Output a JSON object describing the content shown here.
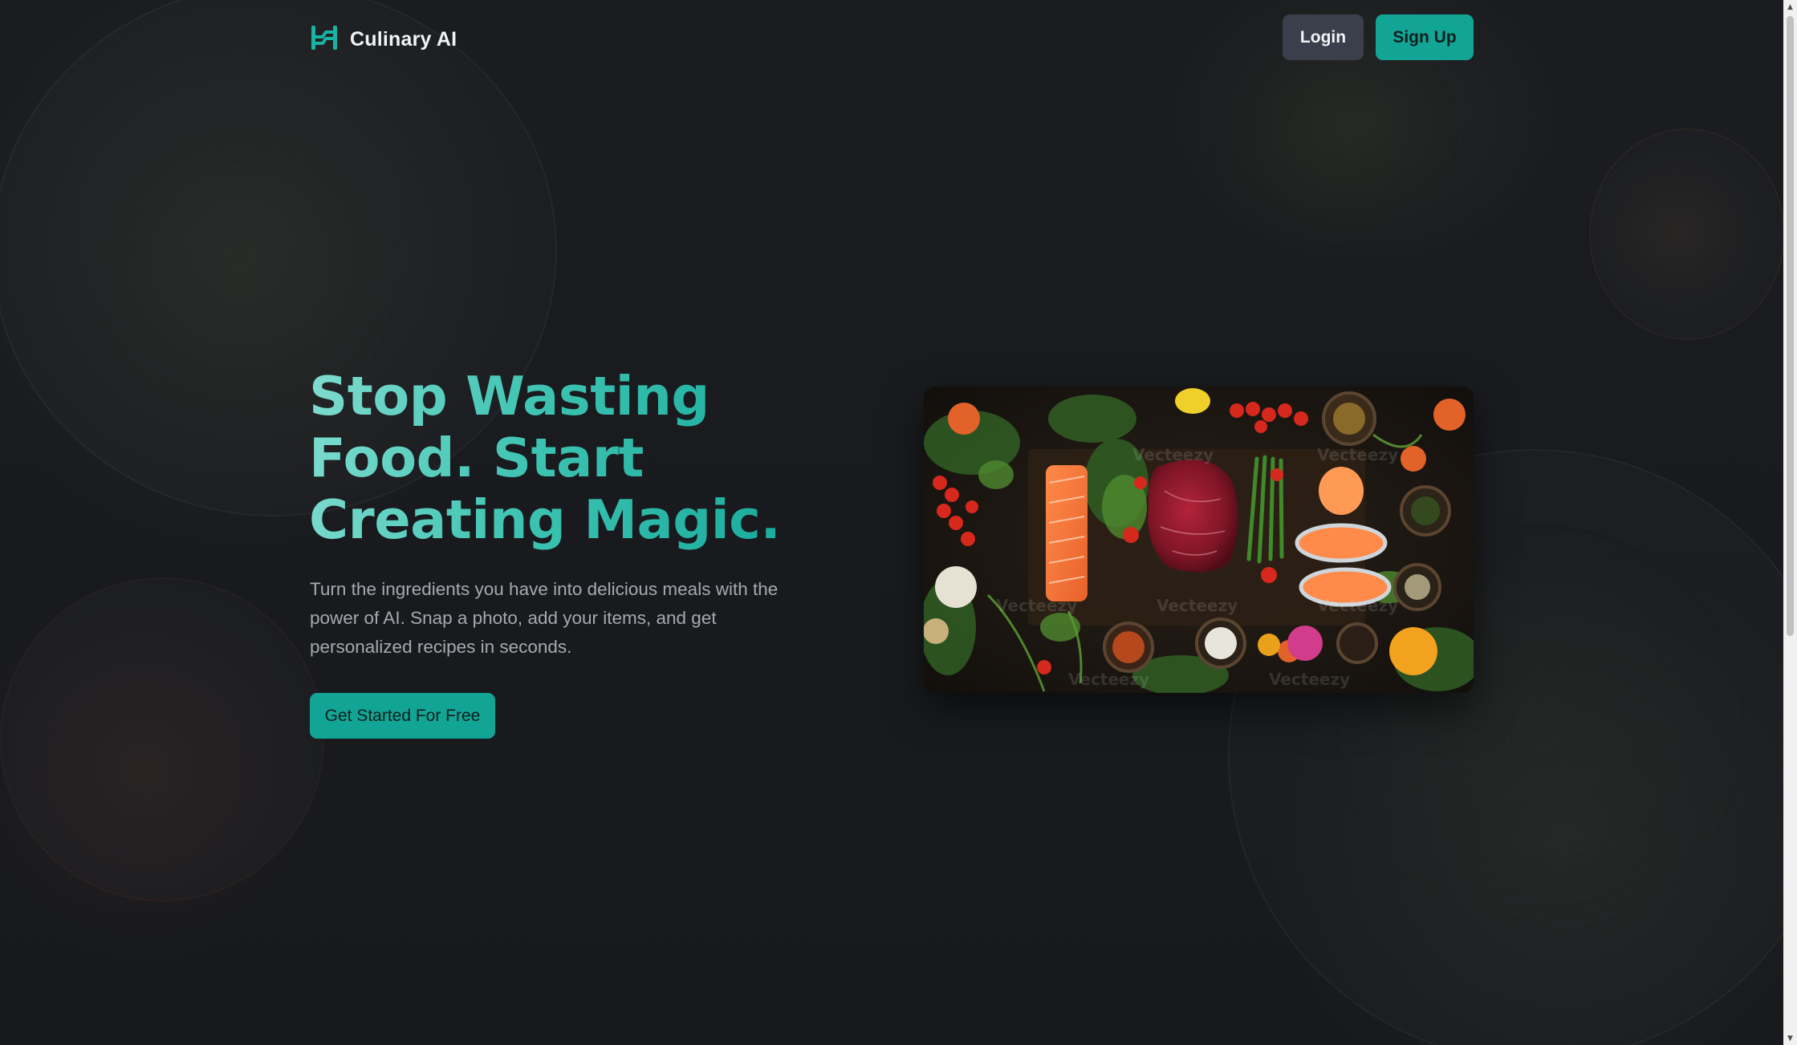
{
  "navbar": {
    "brand_name": "Culinary AI",
    "brand_icon": "culinary-logo-icon",
    "login_label": "Login",
    "signup_label": "Sign Up"
  },
  "hero": {
    "title_line1": "Stop Wasting",
    "title_line2": "Food. Start",
    "title_line3": "Creating Magic.",
    "subtitle": "Turn the ingredients you have into delicious meals with the power of AI. Snap a photo, add your items, and get personalized recipes in seconds.",
    "cta_label": "Get Started For Free",
    "image_subject": "food-ingredients-spread",
    "image_watermark": "Vecteezy"
  },
  "colors": {
    "accent": "#12a596",
    "title_gradient_start": "#7fdccf",
    "title_gradient_end": "#14a89a",
    "background": "#17191c",
    "login_button": "#3a3f4b"
  }
}
